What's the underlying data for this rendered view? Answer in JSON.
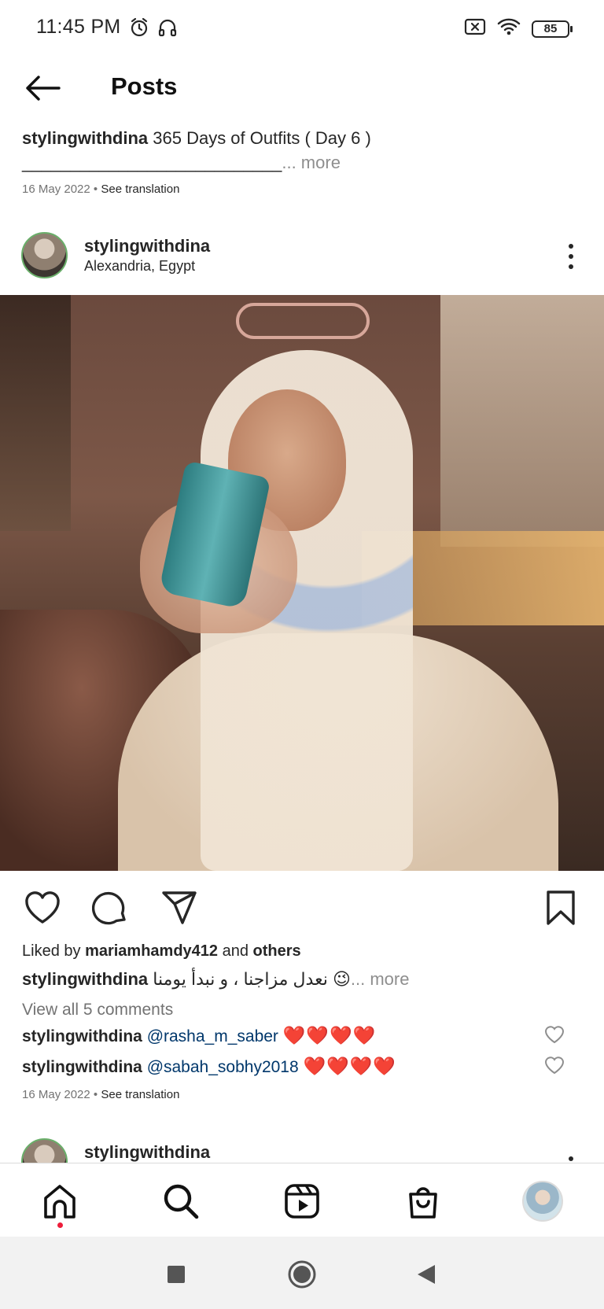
{
  "status_bar": {
    "time": "11:45 PM",
    "battery": "85",
    "icons_left": [
      "alarm-icon",
      "headphones-icon"
    ],
    "icons_right": [
      "no-sim-icon",
      "wifi-icon",
      "battery-icon"
    ]
  },
  "header": {
    "title": "Posts"
  },
  "previous_post": {
    "username": "stylingwithdina",
    "caption": "365 Days of Outfits ( Day 6 )",
    "caption_line2": "___________________________",
    "more": "... more",
    "date": "16 May 2022",
    "separator": "•",
    "see_translation": "See translation"
  },
  "post": {
    "username": "stylingwithdina",
    "location": "Alexandria, Egypt",
    "liked_prefix": "Liked by",
    "liked_user": "mariamhamdy412",
    "liked_and": "and",
    "liked_others": "others",
    "caption_user": "stylingwithdina",
    "caption_text": "نعدل مزاجنا ، و نبدأ يومنا 😉",
    "caption_more": "... more",
    "view_comments": "View all 5 comments",
    "comments": [
      {
        "user": "stylingwithdina",
        "mention": "@rasha_m_saber",
        "hearts": "❤️❤️❤️❤️"
      },
      {
        "user": "stylingwithdina",
        "mention": "@sabah_sobhy2018",
        "hearts": "❤️❤️❤️❤️"
      }
    ],
    "date": "16 May 2022",
    "separator": "•",
    "see_translation": "See translation"
  },
  "next_post": {
    "username": "stylingwithdina"
  },
  "bottom_nav": {
    "items": [
      "home-icon",
      "search-icon",
      "reels-icon",
      "shop-icon",
      "profile-avatar"
    ]
  },
  "colors": {
    "mention": "#00376b",
    "heart": "#e0162b",
    "notification_dot": "#ed1d3a",
    "muted": "#737373"
  }
}
